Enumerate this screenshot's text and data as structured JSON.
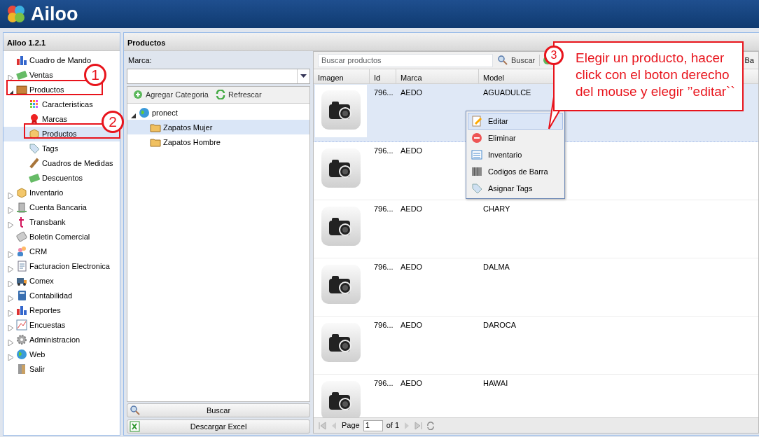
{
  "app": {
    "logo": "Ailoo"
  },
  "sidebar": {
    "title": "Ailoo 1.2.1",
    "items": [
      {
        "label": "Cuadro de Mando",
        "selected": false
      },
      {
        "label": "Ventas",
        "expanded": false,
        "selected": false
      },
      {
        "label": "Productos",
        "expanded": true,
        "selected": false,
        "children": [
          {
            "label": "Caracteristicas",
            "selected": false
          },
          {
            "label": "Marcas",
            "selected": false
          },
          {
            "label": "Productos",
            "selected": true
          },
          {
            "label": "Tags",
            "selected": false
          },
          {
            "label": "Cuadros de Medidas",
            "selected": false
          },
          {
            "label": "Descuentos",
            "selected": false
          }
        ]
      },
      {
        "label": "Inventario",
        "expanded": false,
        "selected": false
      },
      {
        "label": "Cuenta Bancaria",
        "expanded": false,
        "selected": false
      },
      {
        "label": "Transbank",
        "expanded": false,
        "selected": false
      },
      {
        "label": "Boletin Comercial",
        "selected": false
      },
      {
        "label": "CRM",
        "expanded": false,
        "selected": false
      },
      {
        "label": "Facturacion Electronica",
        "expanded": false,
        "selected": false
      },
      {
        "label": "Comex",
        "expanded": false,
        "selected": false
      },
      {
        "label": "Contabilidad",
        "expanded": false,
        "selected": false
      },
      {
        "label": "Reportes",
        "expanded": false,
        "selected": false
      },
      {
        "label": "Encuestas",
        "expanded": false,
        "selected": false
      },
      {
        "label": "Administracion",
        "expanded": false,
        "selected": false
      },
      {
        "label": "Web",
        "expanded": false,
        "selected": false
      },
      {
        "label": "Salir",
        "selected": false
      }
    ]
  },
  "main": {
    "title": "Productos",
    "filter": {
      "label": "Marca:",
      "toolbar": [
        "Agregar Categoria",
        "Refrescar"
      ],
      "tree": [
        {
          "label": "pronect",
          "expanded": true,
          "selected": false,
          "children": [
            {
              "label": "Zapatos Mujer",
              "selected": true
            },
            {
              "label": "Zapatos Hombre",
              "selected": false
            }
          ]
        }
      ],
      "buttons": [
        "Buscar",
        "Descargar Excel"
      ]
    },
    "grid": {
      "search_placeholder": "Buscar productos",
      "search_button": "Buscar",
      "toolbar_cut": "Ba",
      "columns": [
        "Imagen",
        "Id",
        "Marca",
        "Model"
      ],
      "rows": [
        {
          "id": "796...",
          "marca": "AEDO",
          "model": "AGUADULCE",
          "selected": true
        },
        {
          "id": "796...",
          "marca": "AEDO",
          "model": "",
          "selected": false
        },
        {
          "id": "796...",
          "marca": "AEDO",
          "model": "CHARY",
          "selected": false
        },
        {
          "id": "796...",
          "marca": "AEDO",
          "model": "DALMA",
          "selected": false
        },
        {
          "id": "796...",
          "marca": "AEDO",
          "model": "DAROCA",
          "selected": false
        },
        {
          "id": "796...",
          "marca": "AEDO",
          "model": "HAWAI",
          "selected": false
        }
      ],
      "pager": {
        "page_label": "Page",
        "page": "1",
        "of": "of 1"
      }
    },
    "context_menu": [
      {
        "label": "Editar",
        "selected": true
      },
      {
        "label": "Eliminar",
        "selected": false
      },
      {
        "label": "Inventario",
        "selected": false
      },
      {
        "label": "Codigos de Barra",
        "selected": false
      },
      {
        "label": "Asignar Tags",
        "selected": false
      }
    ]
  },
  "annotations": [
    {
      "number": "1"
    },
    {
      "number": "2"
    },
    {
      "number": "3",
      "text": "Elegir un producto, hacer click con el boton derecho del mouse y elegir  ’’editar``"
    }
  ]
}
